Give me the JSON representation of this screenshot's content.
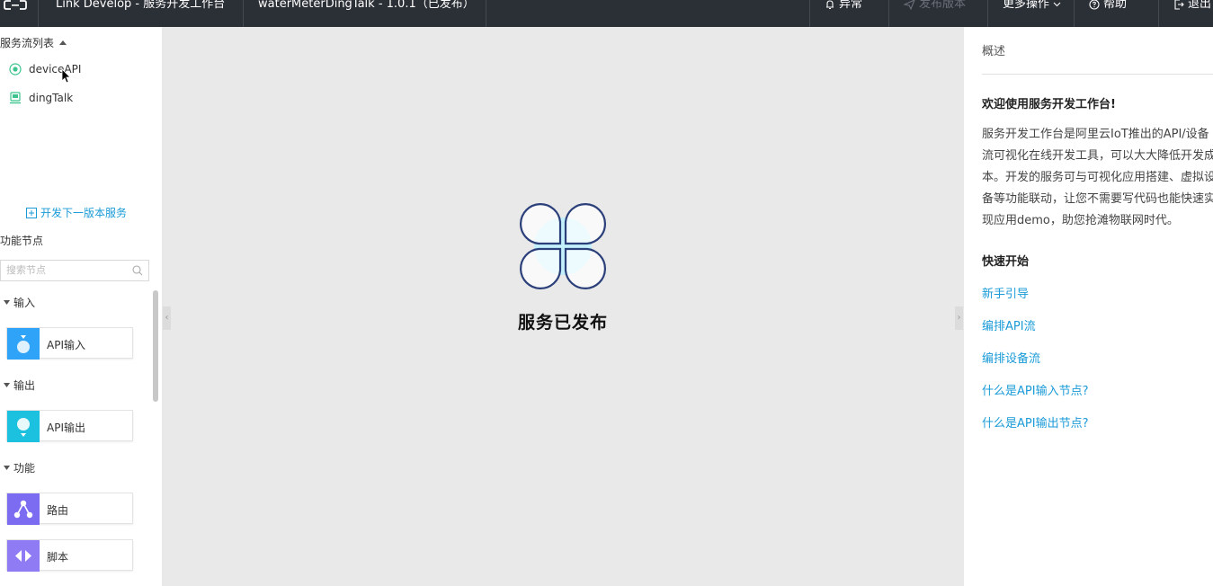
{
  "header": {
    "app_title": "Link Develop - 服务开发工作台",
    "project_version": "waterMeterDingTalk - 1.0.1（已发布）",
    "actions": [
      {
        "label": "异常",
        "icon": "bell-icon"
      },
      {
        "label": "发布版本",
        "icon": "send-icon",
        "disabled": true
      },
      {
        "label": "更多操作",
        "icon": "chevron-down-icon"
      },
      {
        "label": "帮助",
        "icon": "help-icon"
      },
      {
        "label": "退出",
        "icon": "logout-icon"
      }
    ]
  },
  "sidebar": {
    "flow_list_title": "服务流列表",
    "flows": [
      {
        "label": "deviceAPI",
        "icon": "device-radio-icon"
      },
      {
        "label": "dingTalk",
        "icon": "dingtalk-device-icon"
      }
    ],
    "develop_next_label": "开发下一版本服务",
    "nodes_title": "功能节点",
    "search_placeholder": "搜索节点",
    "groups": [
      {
        "title": "输入",
        "nodes": [
          {
            "label": "API输入",
            "icon": "api-input-icon",
            "color": "#2fa3f7"
          }
        ]
      },
      {
        "title": "输出",
        "nodes": [
          {
            "label": "API输出",
            "icon": "api-output-icon",
            "color": "#1cc1e0"
          }
        ]
      },
      {
        "title": "功能",
        "nodes": [
          {
            "label": "路由",
            "icon": "route-icon",
            "color": "#7c6cf2"
          },
          {
            "label": "脚本",
            "icon": "script-icon",
            "color": "#8f7cf5"
          }
        ]
      }
    ]
  },
  "canvas": {
    "status_text": "服务已发布",
    "status_icon": "published-clover-icon",
    "background": "#e9e9e9"
  },
  "overview": {
    "title": "概述",
    "welcome": "欢迎使用服务开发工作台!",
    "description": "服务开发工作台是阿里云IoT推出的API/设备流可视化在线开发工具，可以大大降低开发成本。开发的服务可与可视化应用搭建、虚拟设备等功能联动，让您不需要写代码也能快速实现应用demo，助您抢滩物联网时代。",
    "quickstart_title": "快速开始",
    "links": [
      "新手引导",
      "编排API流",
      "编排设备流",
      "什么是API输入节点?",
      "什么是API输出节点?"
    ]
  },
  "colors": {
    "accent": "#1a9bd7",
    "topbar": "#2b2f36",
    "green": "#3cc48e"
  }
}
